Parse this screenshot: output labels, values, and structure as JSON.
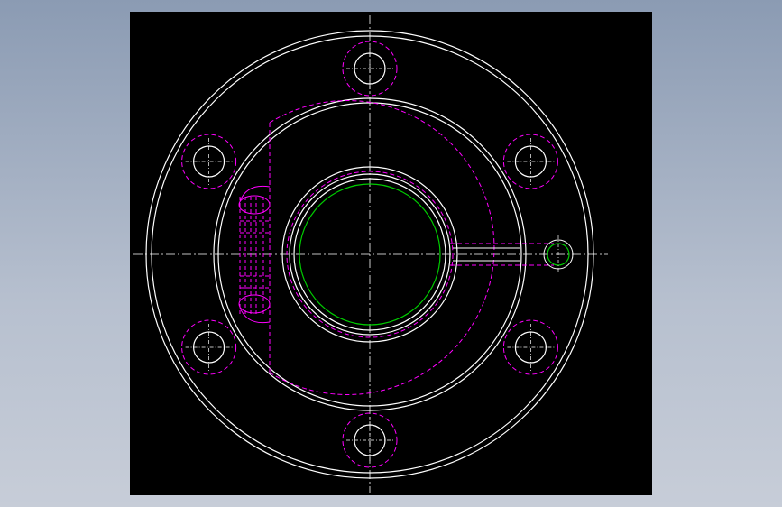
{
  "viewport": {
    "background": "#000000"
  },
  "colors": {
    "geometry": "#ffffff",
    "hidden": "#ff00ff",
    "centerline": "#ffffff",
    "bore": "#00cc00"
  },
  "drawing": {
    "view": "front",
    "bolt_hole_count": 6,
    "features": [
      "outer-flange-circle",
      "inner-flange-circle",
      "hub-circle",
      "bore-circle",
      "bolt-holes",
      "hidden-hub-profile",
      "hidden-side-port",
      "side-port-hole",
      "center-lines"
    ]
  }
}
